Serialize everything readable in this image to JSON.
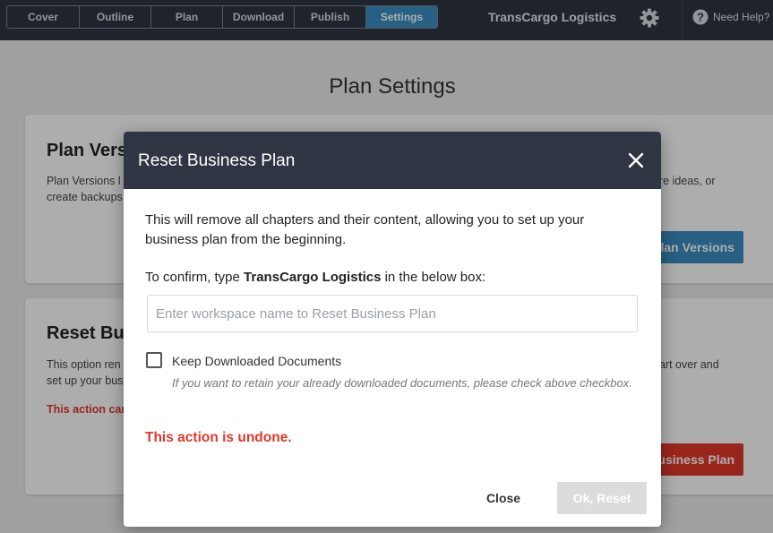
{
  "topbar": {
    "tabs": [
      {
        "label": "Cover"
      },
      {
        "label": "Outline"
      },
      {
        "label": "Plan"
      },
      {
        "label": "Download"
      },
      {
        "label": "Publish"
      },
      {
        "label": "Settings",
        "active": true
      }
    ],
    "brand": "TransCargo Logistics",
    "settings_icon": "gear-icon",
    "help_icon": "question-circle-icon",
    "help_label": "Need Help?"
  },
  "page": {
    "title": "Plan Settings",
    "cards": {
      "versions": {
        "title_visible": "Plan Vers",
        "desc_line1_visible": "Plan Versions l",
        "desc_line2_visible": "create backups",
        "desc_right_visible": "re ideas, or",
        "button_visible": "Plan Versions"
      },
      "reset": {
        "title_visible": "Reset Bus",
        "desc_line1_visible": "This option ren",
        "desc_line2_visible": "set up your bus",
        "desc_right_visible": "art over and",
        "warning_visible": "This action can",
        "button_visible": "usiness Plan"
      }
    }
  },
  "modal": {
    "title": "Reset Business Plan",
    "close_icon": "close-icon",
    "description": "This will remove all chapters and their content, allowing you to set up your business plan from the beginning.",
    "confirm_prefix": "To confirm, type ",
    "confirm_name": "TransCargo Logistics",
    "confirm_suffix": " in the below box:",
    "input_value": "",
    "input_placeholder": "Enter workspace name to Reset Business Plan",
    "checkbox_checked": false,
    "checkbox_label": "Keep Downloaded Documents",
    "checkbox_hint": "If you want to retain your already downloaded documents, please check above checkbox.",
    "warning": "This action is undone.",
    "close_label": "Close",
    "ok_label": "Ok, Reset"
  },
  "colors": {
    "header_bg": "#2f3542",
    "accent_blue": "#3a8ec2",
    "danger_red": "#e0392b",
    "disabled_gray": "#dcdcdc"
  }
}
